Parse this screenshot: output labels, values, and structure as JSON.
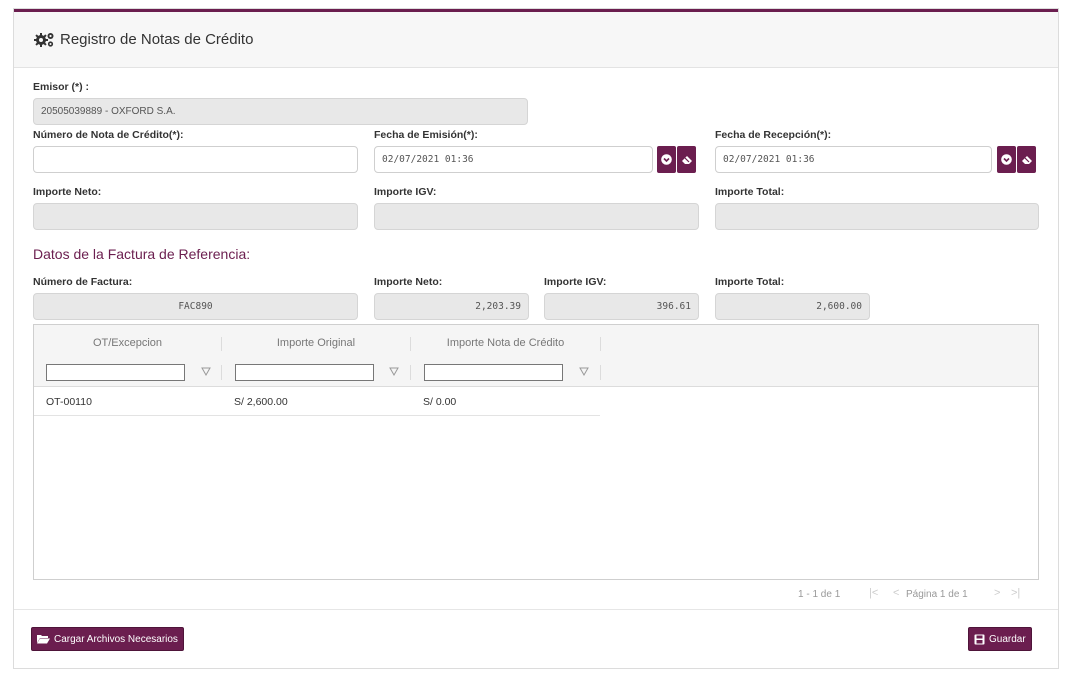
{
  "header": {
    "title": "Registro de Notas de Crédito",
    "icon": "gears-icon"
  },
  "form": {
    "emisor_label": "Emisor (*) :",
    "emisor_value": "20505039889 - OXFORD S.A.",
    "nota_label": "Número de Nota de Crédito(*):",
    "nota_value": "",
    "fecha_emision_label": "Fecha de Emisión(*):",
    "fecha_emision_value": "02/07/2021 01:36",
    "fecha_recepcion_label": "Fecha de Recepción(*):",
    "fecha_recepcion_value": "02/07/2021 01:36",
    "importe_neto_label": "Importe Neto:",
    "importe_neto_value": "",
    "importe_igv_label": "Importe IGV:",
    "importe_igv_value": "",
    "importe_total_label": "Importe Total:",
    "importe_total_value": ""
  },
  "referencia": {
    "title": "Datos de la Factura de Referencia:",
    "numero_label": "Número de Factura:",
    "numero_value": "FAC890",
    "neto_label": "Importe Neto:",
    "neto_value": "2,203.39",
    "igv_label": "Importe IGV:",
    "igv_value": "396.61",
    "total_label": "Importe Total:",
    "total_value": "2,600.00"
  },
  "grid": {
    "columns": [
      "OT/Excepcion",
      "Importe Original",
      "Importe Nota de Crédito"
    ],
    "rows": [
      {
        "ot": "OT-00110",
        "original": "S/ 2,600.00",
        "nota": "S/ 0.00"
      }
    ],
    "pager_count": "1 - 1 de 1",
    "pager_page": "Página 1 de 1"
  },
  "footer": {
    "upload_label": "Cargar Archivos Necesarios",
    "save_label": "Guardar"
  },
  "colors": {
    "accent": "#6b1e4f"
  }
}
